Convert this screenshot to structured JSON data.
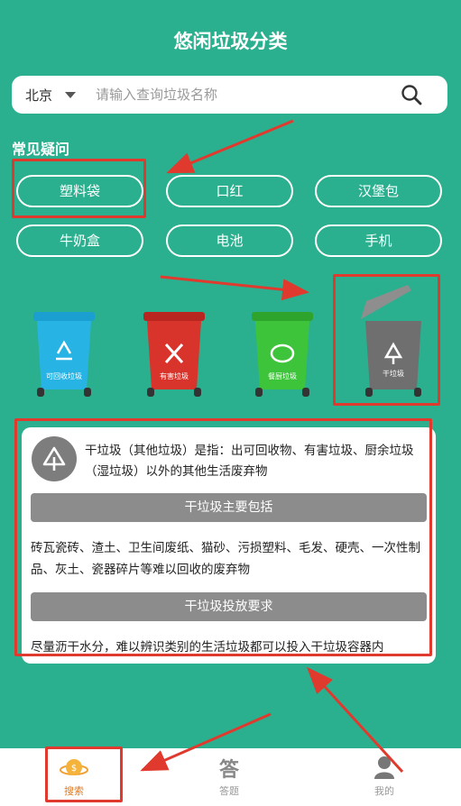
{
  "header": {
    "title": "悠闲垃圾分类"
  },
  "search": {
    "city": "北京",
    "placeholder": "请输入查询垃圾名称"
  },
  "faq": {
    "title": "常见疑问",
    "chips": [
      "塑料袋",
      "口红",
      "汉堡包",
      "牛奶盒",
      "电池",
      "手机"
    ]
  },
  "bins": [
    {
      "label": "可回收垃圾",
      "color": "#27b3e3",
      "icon": "recycle-icon"
    },
    {
      "label": "有害垃圾",
      "color": "#d9342b",
      "icon": "hazard-icon"
    },
    {
      "label": "餐厨垃圾",
      "color": "#3ec43a",
      "icon": "food-waste-icon"
    },
    {
      "label": "干垃圾",
      "color": "#6f6f6f",
      "icon": "dry-waste-icon"
    }
  ],
  "info": {
    "description": "干垃圾（其他垃圾）是指：出可回收物、有害垃圾、厨余垃圾（湿垃圾）以外的其他生活废弃物",
    "includes_title": "干垃圾主要包括",
    "includes_text": "砖瓦瓷砖、渣土、卫生间废纸、猫砂、污损塑料、毛发、硬壳、一次性制品、灰土、瓷器碎片等难以回收的废弃物",
    "requirements_title": "干垃圾投放要求",
    "requirements_text": "尽量沥干水分，难以辨识类别的生活垃圾都可以投入干垃圾容器内"
  },
  "tabbar": {
    "tabs": [
      {
        "label": "搜索",
        "icon": "planet-coin-icon",
        "active": true
      },
      {
        "label": "答题",
        "icon": "answer-icon",
        "glyph": "答",
        "active": false
      },
      {
        "label": "我的",
        "icon": "user-icon",
        "active": false
      }
    ]
  },
  "colors": {
    "background": "#2bb08f",
    "annotation": "#e03a2e",
    "active_tab": "#e07a1f"
  }
}
